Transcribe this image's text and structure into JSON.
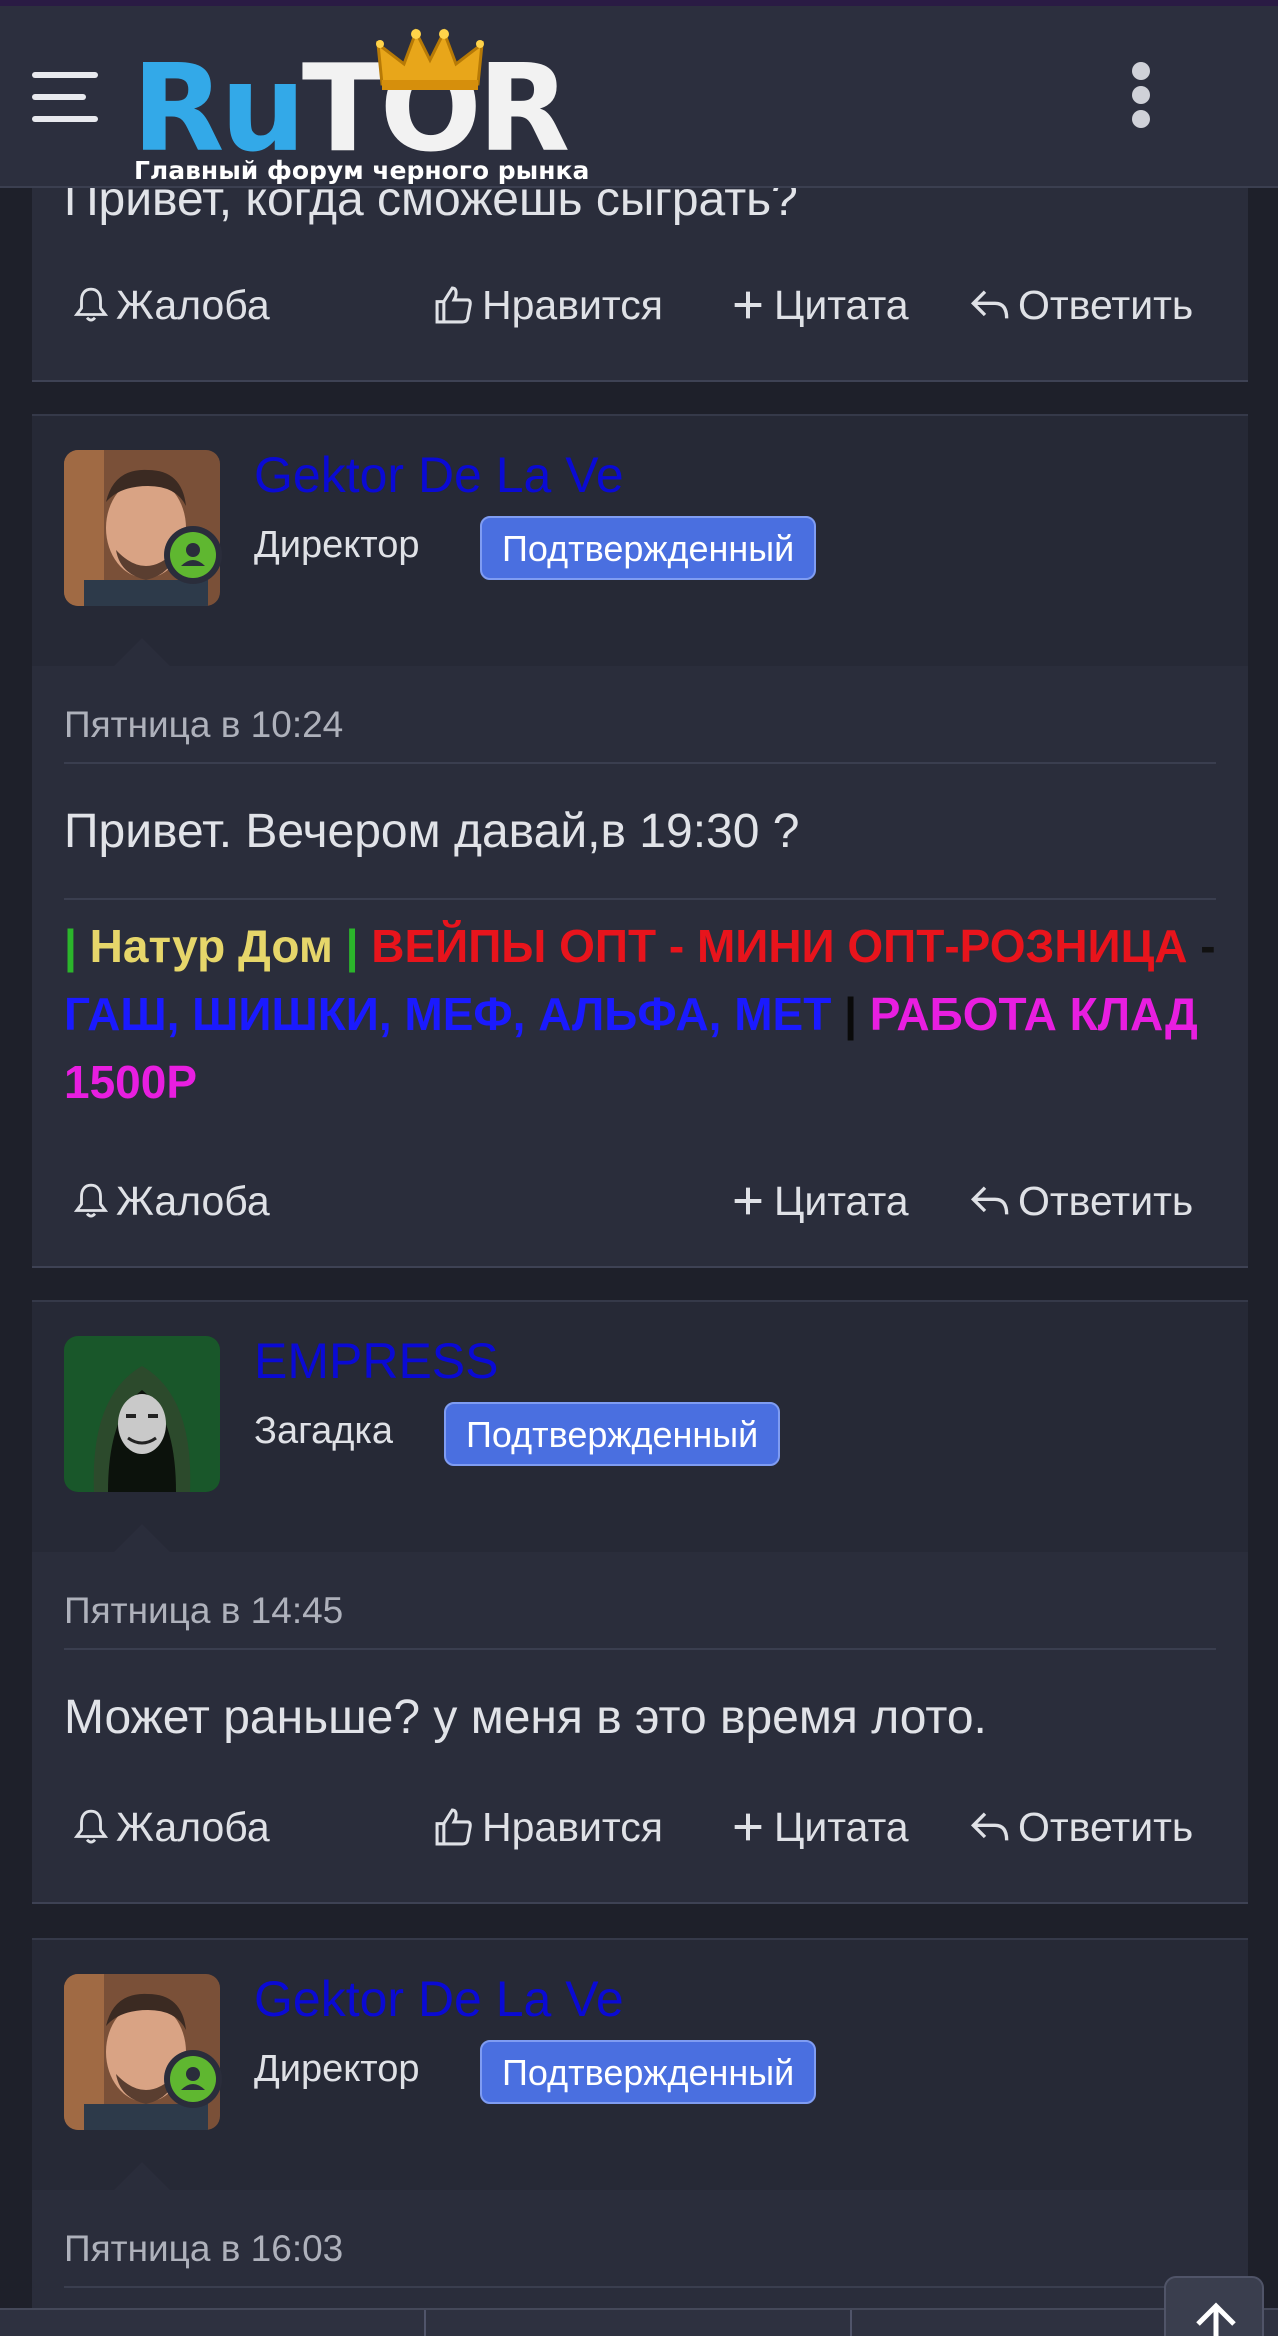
{
  "header": {
    "logo_ru": "Ru",
    "logo_tor": "TOR",
    "logo_subtitle": "Главный форум черного рынка"
  },
  "prev_post": {
    "message_partial": "Привет, когда сможешь сыграть?",
    "actions": {
      "complaint": "Жалоба",
      "like": "Нравится",
      "quote": "Цитата",
      "reply": "Ответить"
    }
  },
  "posts": [
    {
      "username": "Gektor De La Ve",
      "role": "Директор",
      "badge": "Подтвержденный",
      "date": "Пятница в 10:24",
      "message": "Привет. Вечером давай,в 19:30 ?",
      "signature": {
        "bar1": "|",
        "part1": "Натур Дом",
        "bar2": "|",
        "part2": "ВЕЙПЫ ОПТ - МИНИ ОПТ-РОЗНИЦА",
        "dash": "-",
        "part3": "ГАШ, ШИШКИ, МЕФ, АЛЬФА, МЕТ",
        "bar3": "|",
        "part4": "РАБОТА КЛАД 1500Р"
      },
      "actions": {
        "complaint": "Жалоба",
        "quote": "Цитата",
        "reply": "Ответить"
      }
    },
    {
      "username": "EMPRESS",
      "role": "Загадка",
      "badge": "Подтвержденный",
      "date": "Пятница в 14:45",
      "message": "Может раньше? у меня в это время лото.",
      "actions": {
        "complaint": "Жалоба",
        "like": "Нравится",
        "quote": "Цитата",
        "reply": "Ответить"
      }
    },
    {
      "username": "Gektor De La Ve",
      "role": "Директор",
      "badge": "Подтвержденный",
      "date": "Пятница в 16:03"
    }
  ],
  "colors": {
    "username": "#0a0ad4",
    "badge": "#4a6fe0",
    "online": "#5fb730",
    "sig_green": "#2bb52b",
    "sig_yellow": "#e6d66a",
    "sig_red": "#e8141c",
    "sig_blue": "#1a1aff",
    "sig_magenta": "#e81ee0"
  },
  "icons": [
    "menu-icon",
    "crown-icon",
    "kebab-menu-icon",
    "bell-icon",
    "thumbs-up-icon",
    "plus-icon",
    "reply-icon",
    "user-online-icon",
    "arrow-up-icon"
  ]
}
